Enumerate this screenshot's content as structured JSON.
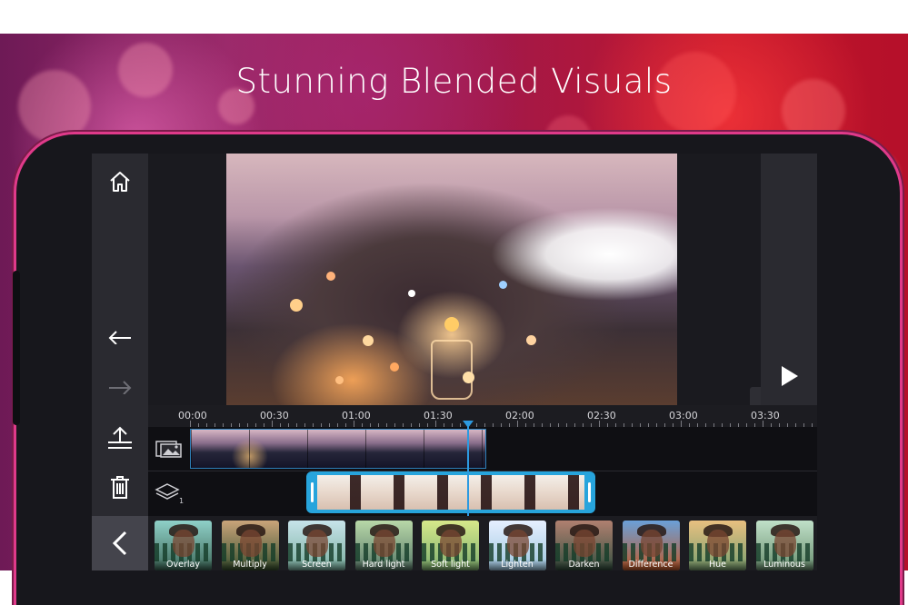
{
  "headline": "Stunning Blended Visuals",
  "toolbar": {
    "home": "home-icon",
    "undo": "undo-icon",
    "redo": "redo-icon",
    "export": "export-icon",
    "delete": "trash-icon",
    "back": "chevron-left-icon"
  },
  "preview": {
    "collapse": "chevron-down-icon",
    "play": "play-icon"
  },
  "timeline": {
    "ticks": [
      "00:00",
      "00:30",
      "01:00",
      "01:30",
      "02:00",
      "02:30",
      "03:00",
      "03:30"
    ],
    "video_track_icon": "video-track-icon",
    "overlay_track_icon": "layers-icon",
    "overlay_count": "1"
  },
  "blend_modes": [
    "Overlay",
    "Multiply",
    "Screen",
    "Hard light",
    "Soft light",
    "Lighten",
    "Darken",
    "Difference",
    "Hue",
    "Luminous"
  ],
  "colors": {
    "accent": "#27a4dc",
    "playhead": "#2d9ae0",
    "frame_glow": "#e03a8a"
  }
}
